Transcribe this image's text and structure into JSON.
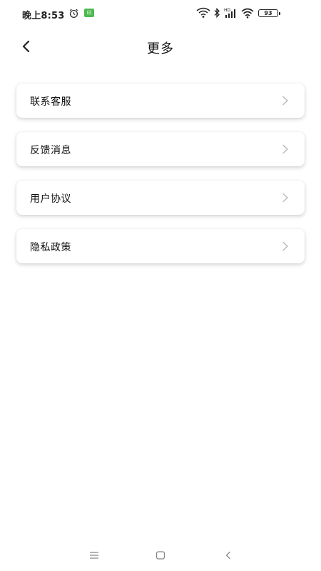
{
  "status_bar": {
    "time": "晚上8:53",
    "battery": "93",
    "icons": [
      "alarm-icon",
      "app-notification-icon",
      "wifi-icon",
      "bluetooth-icon",
      "hd-signal-icon",
      "wifi-icon",
      "battery-icon"
    ]
  },
  "header": {
    "title": "更多",
    "back_icon": "chevron-left-icon"
  },
  "menu": {
    "items": [
      {
        "label": "联系客服"
      },
      {
        "label": "反馈消息"
      },
      {
        "label": "用户协议"
      },
      {
        "label": "隐私政策"
      }
    ]
  },
  "nav_bar": {
    "icons": [
      "menu-icon",
      "home-icon",
      "back-icon"
    ]
  },
  "colors": {
    "background": "#ffffff",
    "text": "#111111",
    "chevron": "#b8b8b8",
    "badge_green": "#4cba4e"
  }
}
